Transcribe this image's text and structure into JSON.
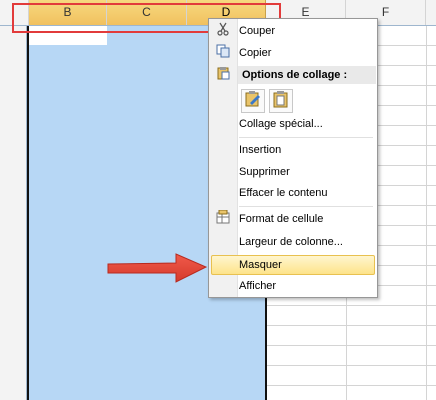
{
  "sheet": {
    "columns": [
      {
        "id": "B",
        "label": "B"
      },
      {
        "id": "C",
        "label": "C"
      },
      {
        "id": "D",
        "label": "D"
      },
      {
        "id": "E",
        "label": "E"
      },
      {
        "id": "F",
        "label": "F"
      }
    ]
  },
  "context_menu": {
    "cut_label": "Couper",
    "copy_label": "Copier",
    "paste_options_label": "Options de collage :",
    "paste_special_label": "Collage spécial...",
    "insert_label": "Insertion",
    "delete_label": "Supprimer",
    "clear_label": "Effacer le contenu",
    "format_label": "Format de cellule",
    "width_label": "Largeur de colonne...",
    "hide_label": "Masquer",
    "unhide_label": "Afficher"
  },
  "icons": {
    "cut": "scissors-icon",
    "copy": "copy-icon",
    "paste": "clipboard-icon",
    "format": "format-cells-icon"
  },
  "colors": {
    "selection": "#b7d7f5",
    "highlight_box": "#e23b3b",
    "arrow": "#e23b3b",
    "menu_hover": "#fde38a",
    "selected_header": "#f1c15f"
  }
}
